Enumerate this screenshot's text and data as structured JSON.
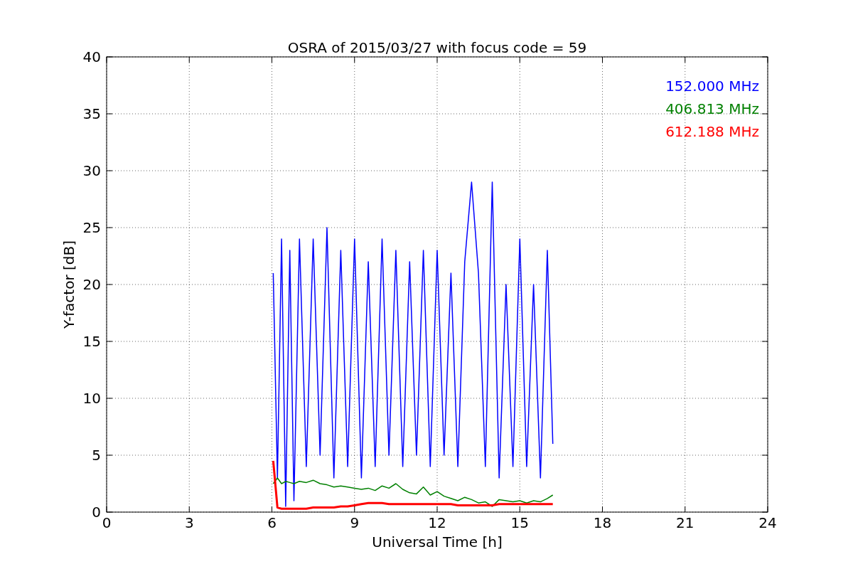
{
  "chart_data": {
    "type": "line",
    "title": "OSRA of 2015/03/27 with focus code = 59",
    "xlabel": "Universal Time [h]",
    "ylabel": "Y-factor [dB]",
    "x": [
      6.05,
      6.2,
      6.35,
      6.5,
      6.65,
      6.8,
      7.0,
      7.25,
      7.5,
      7.75,
      8.0,
      8.25,
      8.5,
      8.75,
      9.0,
      9.25,
      9.5,
      9.75,
      10.0,
      10.25,
      10.5,
      10.75,
      11.0,
      11.25,
      11.5,
      11.75,
      12.0,
      12.25,
      12.5,
      12.75,
      13.0,
      13.25,
      13.5,
      13.75,
      14.0,
      14.25,
      14.5,
      14.75,
      15.0,
      15.25,
      15.5,
      15.75,
      16.0,
      16.2
    ],
    "series": [
      {
        "name": "152.000 MHz",
        "color": "#0000ff",
        "values": [
          21,
          3,
          24,
          0.5,
          23,
          1,
          24,
          4,
          24,
          5,
          25,
          3,
          23,
          4,
          24,
          3,
          22,
          4,
          24,
          5,
          23,
          4,
          22,
          5,
          23,
          4,
          23,
          5,
          21,
          4,
          22,
          29,
          21,
          4,
          29,
          3,
          20,
          4,
          24,
          4,
          20,
          3,
          23,
          6
        ]
      },
      {
        "name": "406.813 MHz",
        "color": "#008000",
        "values": [
          2.5,
          3,
          2.5,
          2.7,
          2.6,
          2.5,
          2.7,
          2.6,
          2.8,
          2.5,
          2.4,
          2.2,
          2.3,
          2.2,
          2.1,
          2.0,
          2.1,
          1.9,
          2.3,
          2.1,
          2.5,
          2.0,
          1.7,
          1.6,
          2.2,
          1.5,
          1.8,
          1.4,
          1.2,
          1.0,
          1.3,
          1.1,
          0.8,
          0.9,
          0.5,
          1.1,
          1.0,
          0.9,
          1.0,
          0.8,
          1.0,
          0.9,
          1.2,
          1.5
        ]
      },
      {
        "name": "612.188 MHz",
        "color": "#ff0000",
        "values": [
          4.5,
          0.4,
          0.3,
          0.3,
          0.3,
          0.3,
          0.3,
          0.3,
          0.4,
          0.4,
          0.4,
          0.4,
          0.5,
          0.5,
          0.6,
          0.7,
          0.8,
          0.8,
          0.8,
          0.7,
          0.7,
          0.7,
          0.7,
          0.7,
          0.7,
          0.7,
          0.7,
          0.7,
          0.7,
          0.6,
          0.6,
          0.6,
          0.6,
          0.6,
          0.6,
          0.7,
          0.7,
          0.7,
          0.7,
          0.7,
          0.7,
          0.7,
          0.7,
          0.7
        ]
      }
    ],
    "xlim": [
      0,
      24
    ],
    "ylim": [
      0,
      40
    ],
    "grid": true,
    "xticks": [
      0,
      3,
      6,
      9,
      12,
      15,
      18,
      21,
      24
    ],
    "yticks": [
      0,
      5,
      10,
      15,
      20,
      25,
      30,
      35,
      40
    ]
  }
}
